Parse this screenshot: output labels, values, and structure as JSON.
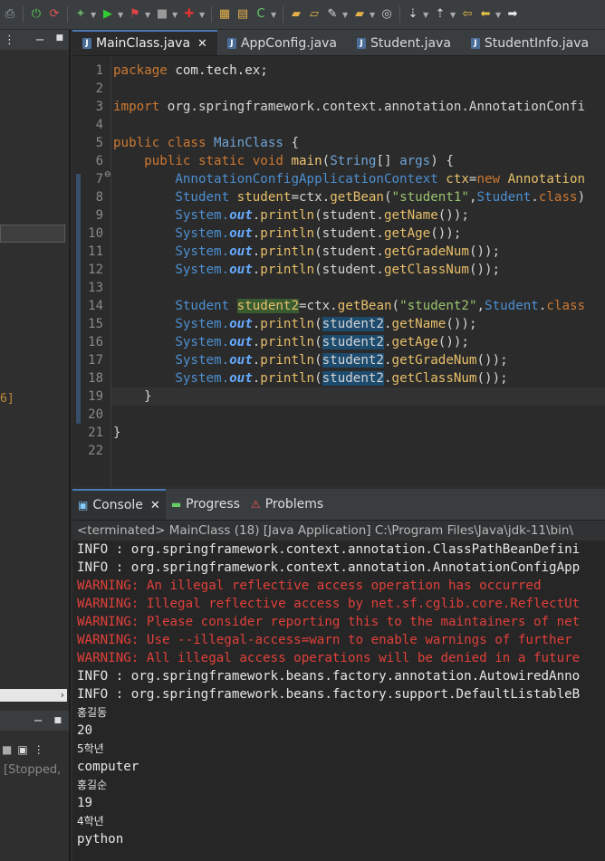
{
  "toolbar": {
    "icons": [
      "print-icon",
      "debug-power-icon",
      "refresh-icon",
      "debug-arrow-icon",
      "run-icon",
      "run-config-icon",
      "stop-icon",
      "coverage-icon",
      "new-java-project-icon",
      "new-package-icon",
      "new-class-icon",
      "open-folder-icon",
      "open-type-icon",
      "brush-icon",
      "search-folder-icon",
      "globe-icon",
      "next-annotation-icon",
      "prev-annotation-icon",
      "back-icon",
      "forward-icon",
      "arrow-right-icon"
    ]
  },
  "left_panel": {
    "top_menu_glyph": "⋮",
    "top_min": "−",
    "top_max": "■",
    "marker_text": "6]",
    "scroll_arrow": "›",
    "bottom_min": "−",
    "bottom_max": "■",
    "stopped_text": "[Stopped,"
  },
  "editor": {
    "tabs": [
      {
        "label": "MainClass.java",
        "active": true
      },
      {
        "label": "AppConfig.java",
        "active": false
      },
      {
        "label": "Student.java",
        "active": false
      },
      {
        "label": "StudentInfo.java",
        "active": false
      }
    ],
    "line_numbers": [
      "1",
      "2",
      "3",
      "4",
      "5",
      "6",
      "7",
      "8",
      "9",
      "10",
      "11",
      "12",
      "13",
      "14",
      "15",
      "16",
      "17",
      "18",
      "19",
      "20",
      "21",
      "22"
    ],
    "code": {
      "l1_kw": "package",
      "l1_rest": " com.tech.ex;",
      "l3_kw": "import",
      "l3_rest": " org.springframework.context.annotation.AnnotationConfi",
      "l5_kw": "public class",
      "l5_type": " MainClass",
      "l5_rest": " {",
      "l6_kw": "    public static void",
      "l6_meth": " main",
      "l6_p1": "(",
      "l6_type": "String",
      "l6_p2": "[] ",
      "l6_arg": "args",
      "l6_p3": ") {",
      "l7_type": "        AnnotationConfigApplicationContext",
      "l7_var": " ctx",
      "l7_eq": "=",
      "l7_kw": "new",
      "l7_rest": " Annotation",
      "l8_type": "        Student",
      "l8_var": " student",
      "l8_eq": "=ctx.",
      "l8_meth": "getBean",
      "l8_p": "(",
      "l8_str": "\"student1\"",
      "l8_c": ",",
      "l8_type2": "Student",
      "l8_d": ".",
      "l8_kw": "class",
      "l8_end": ")",
      "l9_sys": "        System.",
      "l9_out": "out",
      "l9_p": ".",
      "l9_m": "println",
      "l9_a": "(student.",
      "l9_g": "getName",
      "l9_e": "());",
      "l10_sys": "        System.",
      "l10_out": "out",
      "l10_p": ".",
      "l10_m": "println",
      "l10_a": "(student.",
      "l10_g": "getAge",
      "l10_e": "());",
      "l11_sys": "        System.",
      "l11_out": "out",
      "l11_p": ".",
      "l11_m": "println",
      "l11_a": "(student.",
      "l11_g": "getGradeNum",
      "l11_e": "());",
      "l12_sys": "        System.",
      "l12_out": "out",
      "l12_p": ".",
      "l12_m": "println",
      "l12_a": "(student.",
      "l12_g": "getClassNum",
      "l12_e": "());",
      "l14_type": "        Student",
      "l14_sp": " ",
      "l14_var": "student2",
      "l14_eq": "=ctx.",
      "l14_meth": "getBean",
      "l14_p": "(",
      "l14_str": "\"student2\"",
      "l14_c": ",",
      "l14_type2": "Student",
      "l14_d": ".",
      "l14_kw": "class",
      "l15_sys": "        System.",
      "l15_out": "out",
      "l15_p": ".",
      "l15_m": "println",
      "l15_a": "(",
      "l15_v": "student2",
      "l15_dot": ".",
      "l15_g": "getName",
      "l15_e": "());",
      "l16_sys": "        System.",
      "l16_out": "out",
      "l16_p": ".",
      "l16_m": "println",
      "l16_a": "(",
      "l16_v": "student2",
      "l16_dot": ".",
      "l16_g": "getAge",
      "l16_e": "());",
      "l17_sys": "        System.",
      "l17_out": "out",
      "l17_p": ".",
      "l17_m": "println",
      "l17_a": "(",
      "l17_v": "student2",
      "l17_dot": ".",
      "l17_g": "getGradeNum",
      "l17_e": "());",
      "l18_sys": "        System.",
      "l18_out": "out",
      "l18_p": ".",
      "l18_m": "println",
      "l18_a": "(",
      "l18_v": "student2",
      "l18_dot": ".",
      "l18_g": "getClassNum",
      "l18_e": "());",
      "l19": "    }",
      "l21": "}"
    }
  },
  "console": {
    "tabs": [
      {
        "label": "Console",
        "active": true,
        "icon": "console-icon"
      },
      {
        "label": "Progress",
        "active": false,
        "icon": "progress-icon"
      },
      {
        "label": "Problems",
        "active": false,
        "icon": "problems-icon"
      }
    ],
    "status": "<terminated> MainClass (18) [Java Application] C:\\Program Files\\Java\\jdk-11\\bin\\",
    "lines": [
      {
        "text": "INFO : org.springframework.context.annotation.ClassPathBeanDefini",
        "kind": "info"
      },
      {
        "text": "INFO : org.springframework.context.annotation.AnnotationConfigApp",
        "kind": "info"
      },
      {
        "text": "WARNING: An illegal reflective access operation has occurred",
        "kind": "warn"
      },
      {
        "text": "WARNING: Illegal reflective access by net.sf.cglib.core.ReflectUt",
        "kind": "warn"
      },
      {
        "text": "WARNING: Please consider reporting this to the maintainers of net",
        "kind": "warn"
      },
      {
        "text": "WARNING: Use --illegal-access=warn to enable warnings of further",
        "kind": "warn"
      },
      {
        "text": "WARNING: All illegal access operations will be denied in a future",
        "kind": "warn"
      },
      {
        "text": "INFO : org.springframework.beans.factory.annotation.AutowiredAnno",
        "kind": "info"
      },
      {
        "text": "INFO : org.springframework.beans.factory.support.DefaultListableB",
        "kind": "info"
      },
      {
        "text": "홍길동",
        "kind": "small"
      },
      {
        "text": "20",
        "kind": "info"
      },
      {
        "text": "5학년",
        "kind": "small"
      },
      {
        "text": "computer",
        "kind": "info"
      },
      {
        "text": "홍길순",
        "kind": "small"
      },
      {
        "text": "19",
        "kind": "info"
      },
      {
        "text": "4학년",
        "kind": "small"
      },
      {
        "text": "python",
        "kind": "info"
      }
    ]
  }
}
